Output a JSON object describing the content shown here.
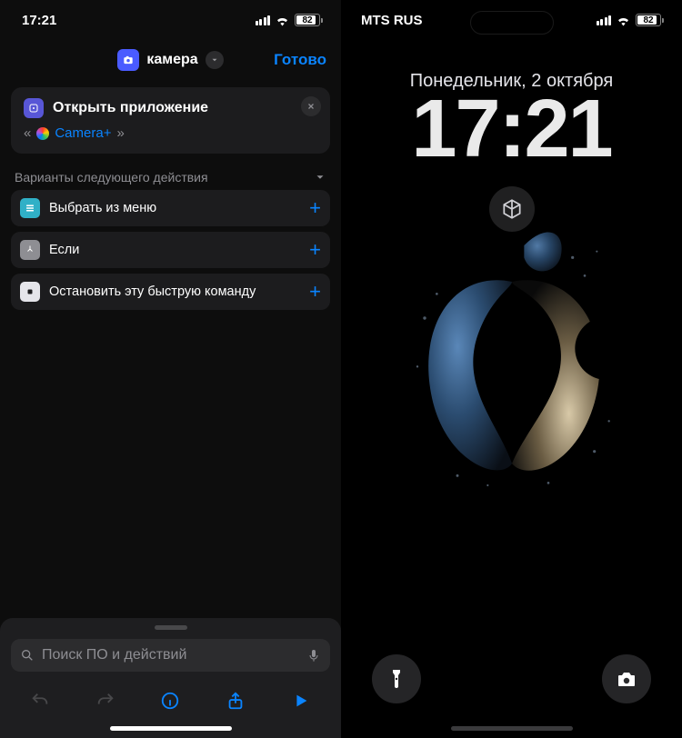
{
  "left": {
    "status": {
      "time": "17:21",
      "battery": "82"
    },
    "nav": {
      "title": "камера",
      "done": "Готово"
    },
    "card": {
      "title": "Открыть приложение",
      "prefix": "«",
      "app": "Camera+",
      "suffix": "»"
    },
    "suggestions": {
      "header": "Варианты следующего действия",
      "items": [
        {
          "label": "Выбрать из меню",
          "icon": "menu",
          "color": "#30b0c7"
        },
        {
          "label": "Если",
          "icon": "branch",
          "color": "#8e8e93"
        },
        {
          "label": "Остановить эту быструю команду",
          "icon": "stop",
          "color": "#e5e5ea"
        }
      ]
    },
    "search": {
      "placeholder": "Поиск ПО и действий"
    }
  },
  "right": {
    "status": {
      "carrier": "MTS RUS",
      "battery": "82"
    },
    "date": "Понедельник, 2 октября",
    "time": "17:21"
  }
}
